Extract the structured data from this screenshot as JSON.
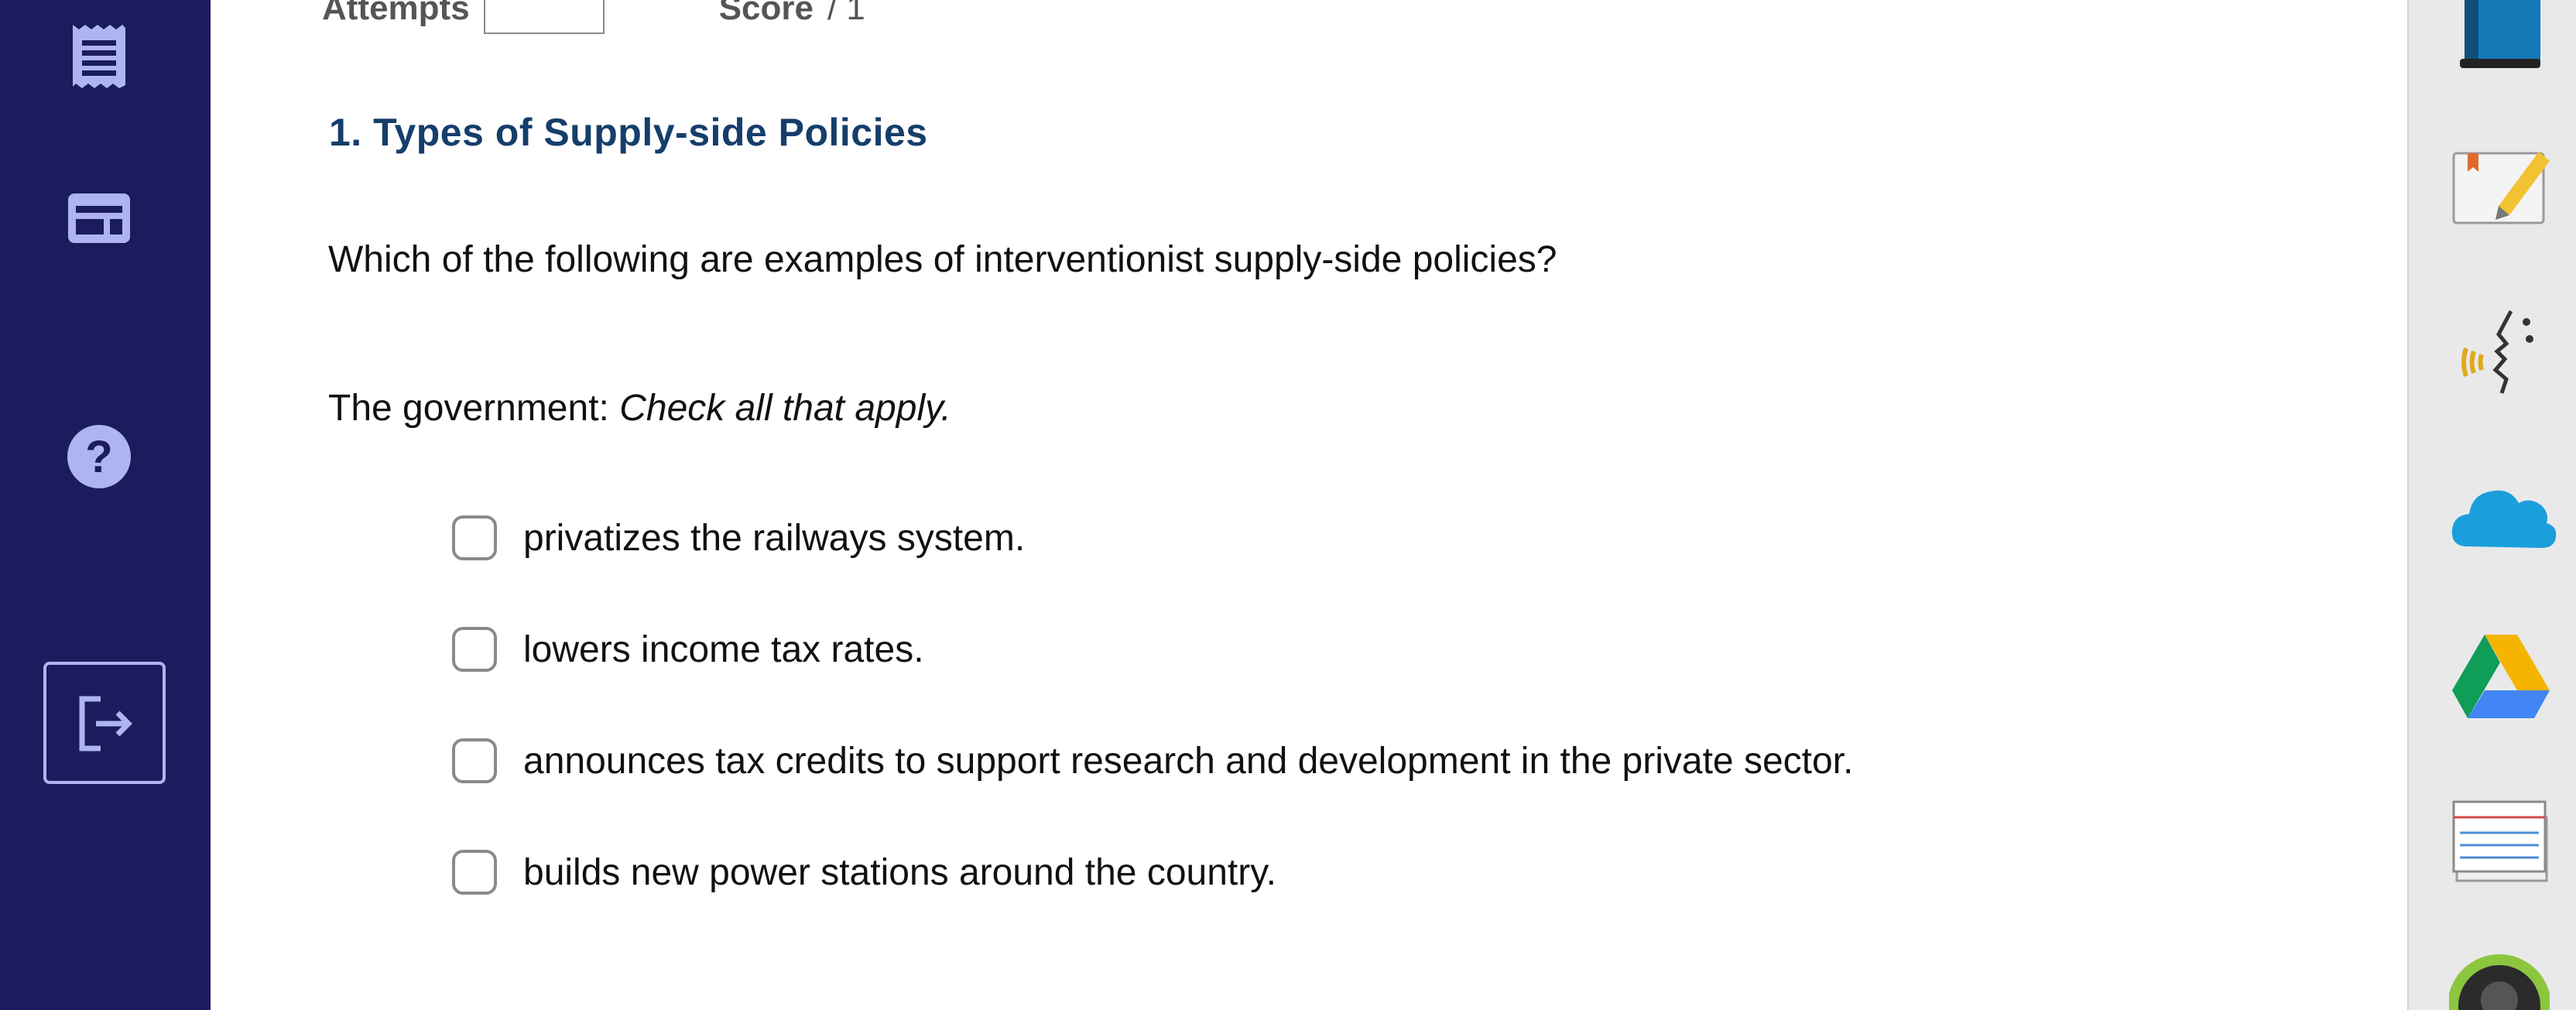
{
  "header": {
    "attempts_label": "Attempts",
    "score_label": "Score",
    "score_value": "/ 1"
  },
  "question": {
    "title": "1. Types of Supply-side Policies",
    "prompt": "Which of the following are examples of interventionist supply-side policies?",
    "instruction_lead": "The government:",
    "instruction_note": "Check all that apply.",
    "options": [
      {
        "label": "privatizes the railways system.",
        "checked": false
      },
      {
        "label": "lowers income tax rates.",
        "checked": false
      },
      {
        "label": "announces tax credits to support research and development in the private sector.",
        "checked": false
      },
      {
        "label": "builds new power stations around the country.",
        "checked": false
      }
    ]
  },
  "left_nav": {
    "background": "#1b1b5e",
    "icons": [
      "receipt-icon",
      "layout-icon",
      "help-icon",
      "logout-icon"
    ]
  },
  "right_dock": {
    "background": "#e9e9e9",
    "icons": [
      "book-icon",
      "notes-icon",
      "speech-icon",
      "onedrive-icon",
      "google-drive-icon",
      "index-cards-icon",
      "profile-ring-icon"
    ]
  },
  "colors": {
    "title": "#153e6b",
    "nav_accent": "#aeb4f0"
  }
}
